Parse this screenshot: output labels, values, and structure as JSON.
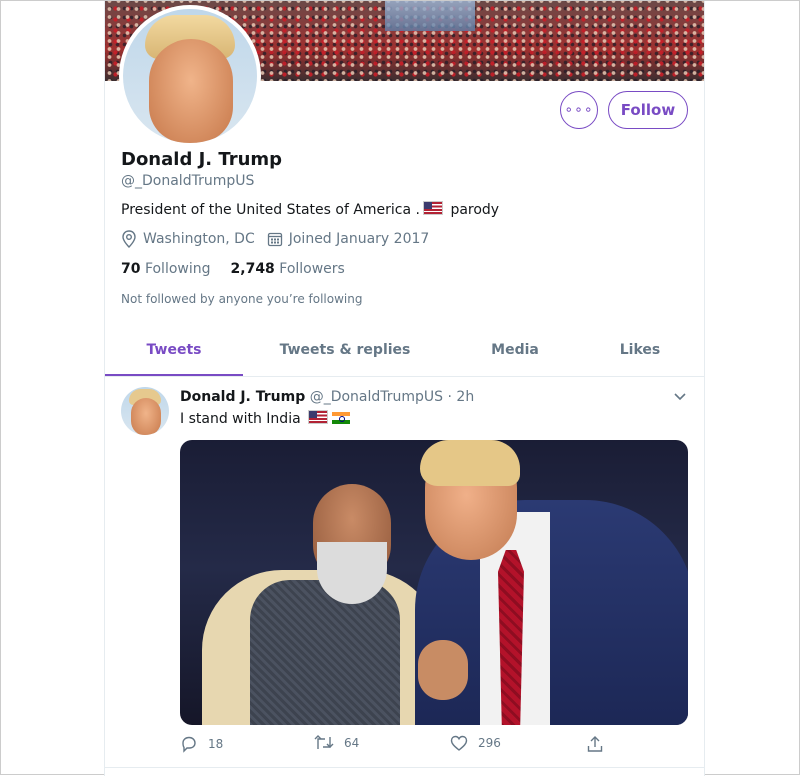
{
  "profile": {
    "name": "Donald J. Trump",
    "handle": "@_DonaldTrumpUS",
    "bio_text": "President of the United States of America .",
    "bio_suffix": "parody",
    "location": "Washington, DC",
    "joined": "Joined January 2017",
    "following_count": "70",
    "following_label": "Following",
    "followers_count": "2,748",
    "followers_label": "Followers",
    "not_followed": "Not followed by anyone you’re following",
    "follow_button": "Follow",
    "more_button": "∘∘∘"
  },
  "tabs": [
    {
      "label": "Tweets",
      "active": true
    },
    {
      "label": "Tweets & replies",
      "active": false
    },
    {
      "label": "Media",
      "active": false
    },
    {
      "label": "Likes",
      "active": false
    }
  ],
  "tweet": {
    "author": "Donald J. Trump",
    "handle": "@_DonaldTrumpUS",
    "separator": "·",
    "time": "2h",
    "text": "I stand with India",
    "replies": "18",
    "retweets": "64",
    "likes": "296"
  },
  "colors": {
    "accent": "#794bc4",
    "muted": "#657786",
    "border": "#e6ecf0"
  }
}
